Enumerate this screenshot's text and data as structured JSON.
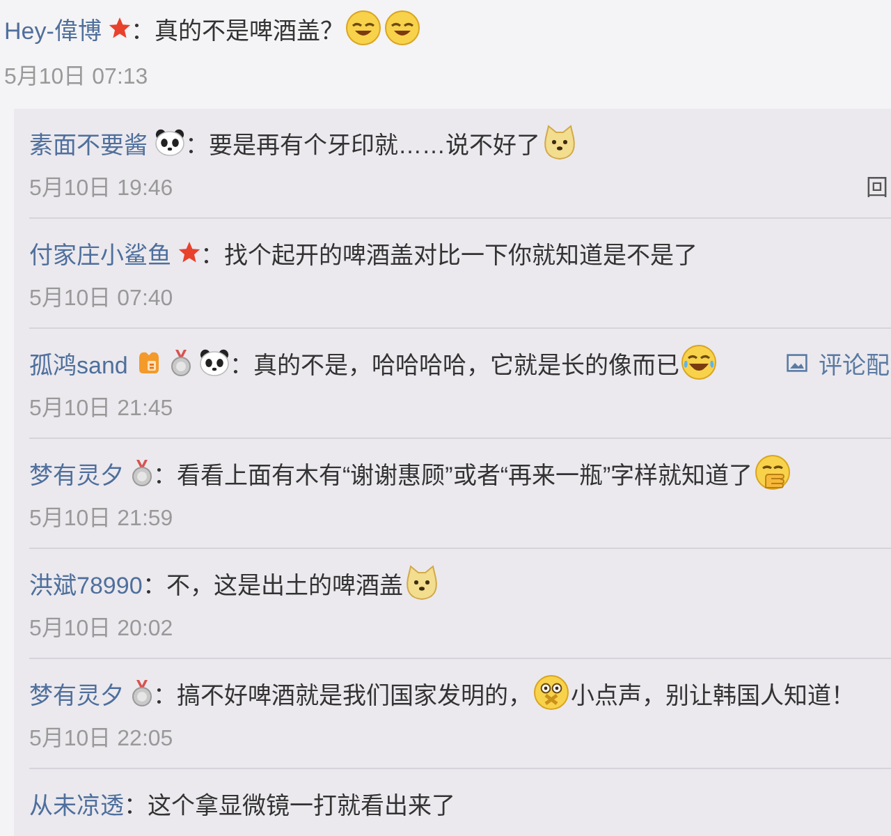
{
  "comment": {
    "author": "Hey-偉博",
    "badges": [
      {
        "kind": "star"
      }
    ],
    "content": [
      {
        "kind": "text",
        "text": "：真的不是啤酒盖？"
      },
      {
        "kind": "sleepy"
      },
      {
        "kind": "sleepy"
      }
    ],
    "time": "5月10日 07:13"
  },
  "replies": [
    {
      "author": "素面不要酱",
      "badges": [
        {
          "kind": "panda"
        }
      ],
      "content": [
        {
          "kind": "text",
          "text": "：要是再有个牙印就……说不好了"
        },
        {
          "kind": "doge"
        }
      ],
      "time": "5月10日 19:46",
      "link": {
        "kind": "reply",
        "text": "回"
      }
    },
    {
      "author": "付家庄小鲨鱼",
      "badges": [
        {
          "kind": "star"
        }
      ],
      "content": [
        {
          "kind": "text",
          "text": "：找个起开的啤酒盖对比一下你就知道是不是了"
        }
      ],
      "time": "5月10日 07:40"
    },
    {
      "author": "孤鸿sand",
      "badges": [
        {
          "kind": "level"
        },
        {
          "kind": "medal"
        },
        {
          "kind": "panda"
        }
      ],
      "content": [
        {
          "kind": "text",
          "text": "：真的不是，哈哈哈哈，它就是长的像而已"
        },
        {
          "kind": "laugh"
        }
      ],
      "time": "5月10日 21:45",
      "link": {
        "kind": "image",
        "text": "评论配"
      }
    },
    {
      "author": "梦有灵夕",
      "badges": [
        {
          "kind": "medal"
        }
      ],
      "content": [
        {
          "kind": "text",
          "text": "：看看上面有木有“谢谢惠顾”或者“再来一瓶”字样就知道了"
        },
        {
          "kind": "cover"
        }
      ],
      "time": "5月10日 21:59"
    },
    {
      "author": "洪斌78990",
      "content": [
        {
          "kind": "text",
          "text": "：不，这是出土的啤酒盖"
        },
        {
          "kind": "doge"
        }
      ],
      "time": "5月10日 20:02"
    },
    {
      "author": "梦有灵夕",
      "badges": [
        {
          "kind": "medal"
        }
      ],
      "content": [
        {
          "kind": "text",
          "text": "：搞不好啤酒就是我们国家发明的，"
        },
        {
          "kind": "shush"
        },
        {
          "kind": "text",
          "text": "小点声，别让韩国人知道！"
        }
      ],
      "time": "5月10日 22:05"
    },
    {
      "author": "从未凉透",
      "content": [
        {
          "kind": "text",
          "text": "：这个拿显微镜一打就看出来了"
        }
      ]
    }
  ]
}
